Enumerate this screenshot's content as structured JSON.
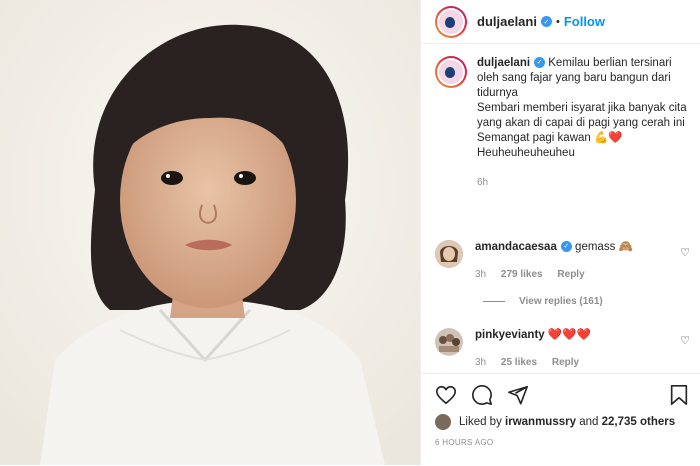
{
  "post": {
    "username": "duljaelani",
    "verified_icon": "verified-badge-icon",
    "dot": "•",
    "follow_label": "Follow"
  },
  "caption": {
    "username": "duljaelani",
    "lines": [
      "Kemilau berlian tersinari oleh sang fajar yang baru bangun dari tidurnya",
      "Sembari memberi isyarat jika banyak cita yang akan di capai di pagi yang cerah ini",
      "Semangat pagi kawan 💪❤️",
      "Heuheuheuheuheu"
    ],
    "time": "6h"
  },
  "comments": [
    {
      "username": "amandacaesaa",
      "text": "gemass 🙈",
      "time": "3h",
      "likes": "279 likes",
      "reply": "Reply"
    },
    {
      "username": "pinkyevianty",
      "text": "❤️❤️❤️",
      "time": "3h",
      "likes": "25 likes",
      "reply": "Reply"
    }
  ],
  "view_replies": "View replies (161)",
  "likes": {
    "prefix": "Liked by ",
    "user": "irwanmussry",
    "mid": " and ",
    "others": "22,735 others"
  },
  "timestamp": "6 HOURS AGO",
  "colors": {
    "accent": "#0095f6",
    "verified": "#3897f0",
    "heart": "#ed4956",
    "muted": "#8e8e8e"
  }
}
